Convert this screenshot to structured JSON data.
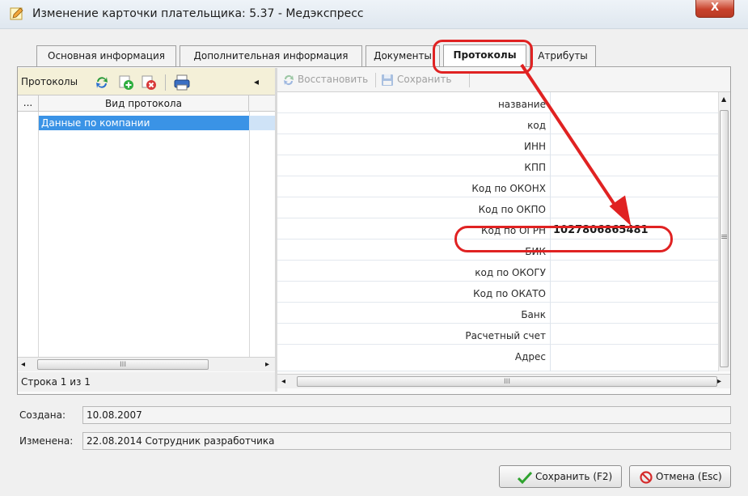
{
  "window": {
    "title": "Изменение карточки плательщика: 5.37 - Медэкспресс",
    "close_glyph": "X"
  },
  "tabs": [
    {
      "label": "Основная информация"
    },
    {
      "label": "Дополнительная информация"
    },
    {
      "label": "Документы"
    },
    {
      "label": "Протоколы",
      "active": true
    },
    {
      "label": "Атрибуты"
    }
  ],
  "left_pane": {
    "toolbar_label": "Протоколы",
    "collapse_glyph": "◂",
    "grid": {
      "col_dots": "...",
      "col_title": "Вид протокола",
      "rows": [
        "Данные по компании"
      ]
    },
    "hscroll_thumb_glyph": "III",
    "status": "Строка 1 из 1"
  },
  "right_pane": {
    "restore_label": "Восстановить",
    "save_label": "Сохранить",
    "properties": [
      {
        "label": "название",
        "value": ""
      },
      {
        "label": "код",
        "value": ""
      },
      {
        "label": "ИНН",
        "value": ""
      },
      {
        "label": "КПП",
        "value": ""
      },
      {
        "label": "Код по ОКОНХ",
        "value": ""
      },
      {
        "label": "Код по ОКПО",
        "value": ""
      },
      {
        "label": "Код по ОГРН",
        "value": "1027806865481"
      },
      {
        "label": "БИК",
        "value": ""
      },
      {
        "label": "код по ОКОГУ",
        "value": ""
      },
      {
        "label": "Код по ОКАТО",
        "value": ""
      },
      {
        "label": "Банк",
        "value": ""
      },
      {
        "label": "Расчетный счет",
        "value": ""
      },
      {
        "label": "Адрес",
        "value": ""
      }
    ],
    "vscroll_grip_glyph": "≡",
    "hscroll_thumb_glyph": "III"
  },
  "footer": {
    "created_label": "Создана:",
    "created_value": "10.08.2007",
    "modified_label": "Изменена:",
    "modified_value": "22.08.2014 Сотрудник разработчика"
  },
  "buttons": {
    "save": "Сохранить (F2)",
    "cancel": "Отмена (Esc)"
  },
  "colors": {
    "selection": "#3a93e6",
    "annotation_red": "#e02222",
    "toolbar_yellow": "#f4f0d8"
  }
}
